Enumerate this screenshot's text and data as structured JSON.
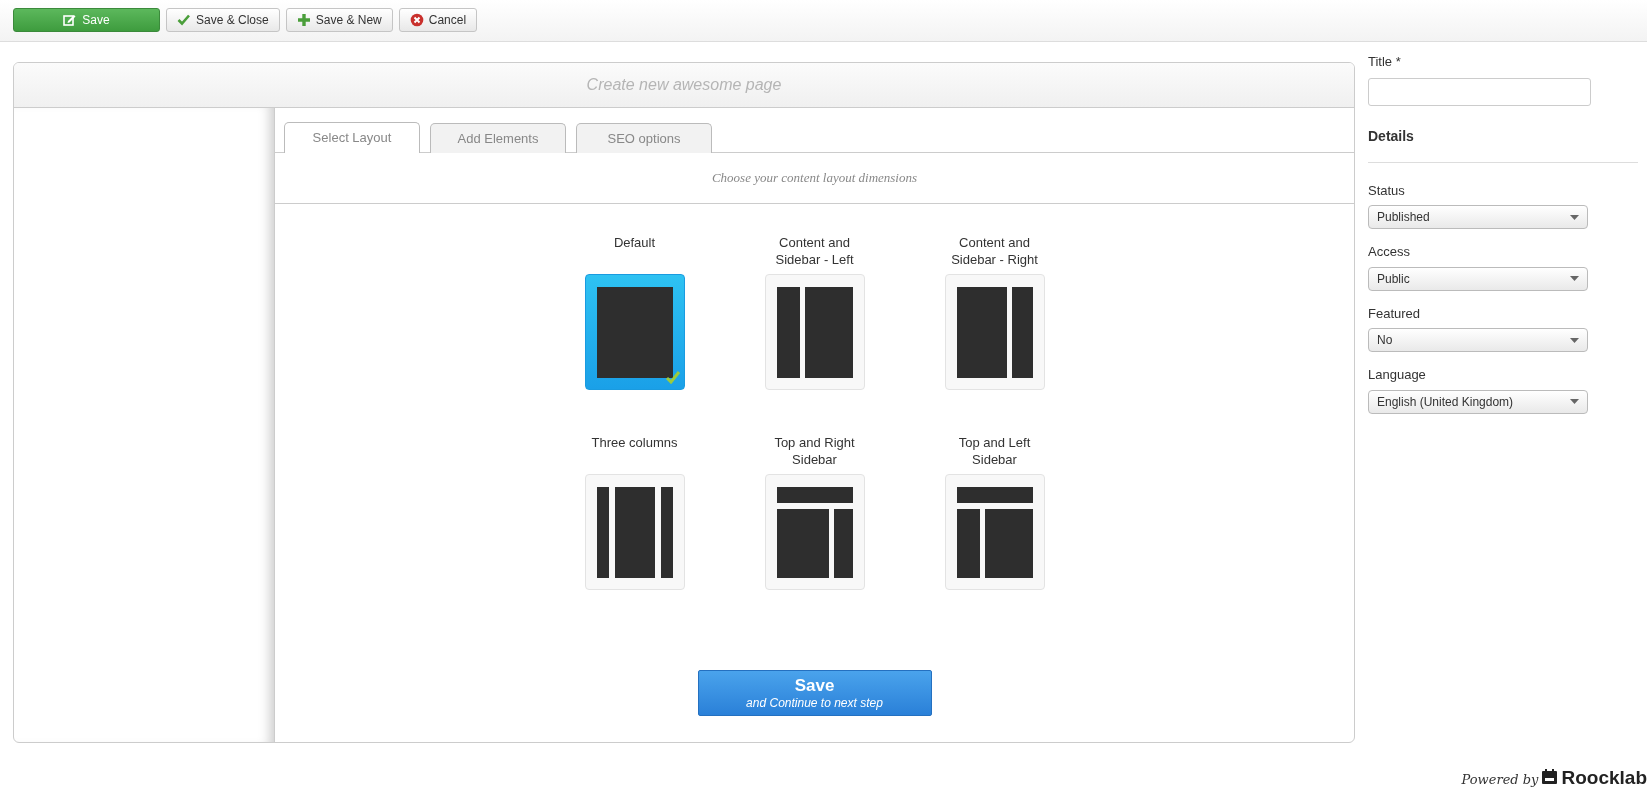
{
  "toolbar": [
    {
      "label": "Save",
      "kind": "save"
    },
    {
      "label": "Save & Close",
      "kind": "save-close"
    },
    {
      "label": "Save & New",
      "kind": "save-new"
    },
    {
      "label": "Cancel",
      "kind": "cancel"
    }
  ],
  "page_heading": "Create new awesome page",
  "tabs": [
    {
      "label": "Select Layout",
      "selected": true
    },
    {
      "label": "Add Elements",
      "selected": false
    },
    {
      "label": "SEO options",
      "selected": false
    }
  ],
  "instruction": "Choose your content layout dimensions",
  "layouts": [
    {
      "label": "Default",
      "kind": "single",
      "selected": true
    },
    {
      "label": "Content and Sidebar - Left",
      "kind": "sidebar-left",
      "selected": false
    },
    {
      "label": "Content and Sidebar - Right",
      "kind": "sidebar-right",
      "selected": false
    },
    {
      "label": "Three columns",
      "kind": "three-columns",
      "selected": false
    },
    {
      "label": "Top and Right Sidebar",
      "kind": "top-right",
      "selected": false
    },
    {
      "label": "Top and Left Sidebar",
      "kind": "top-left",
      "selected": false
    }
  ],
  "continue_button": {
    "label": "Save",
    "sublabel": "and Continue to next step"
  },
  "sidebar": {
    "title_label": "Title *",
    "details_heading": "Details",
    "fields": [
      {
        "label": "Status",
        "value": "Published"
      },
      {
        "label": "Access",
        "value": "Public"
      },
      {
        "label": "Featured",
        "value": "No"
      },
      {
        "label": "Language",
        "value": "English (United Kingdom)"
      }
    ]
  },
  "footer": {
    "powered_by": "Powered by",
    "brand": "Roocklab"
  }
}
